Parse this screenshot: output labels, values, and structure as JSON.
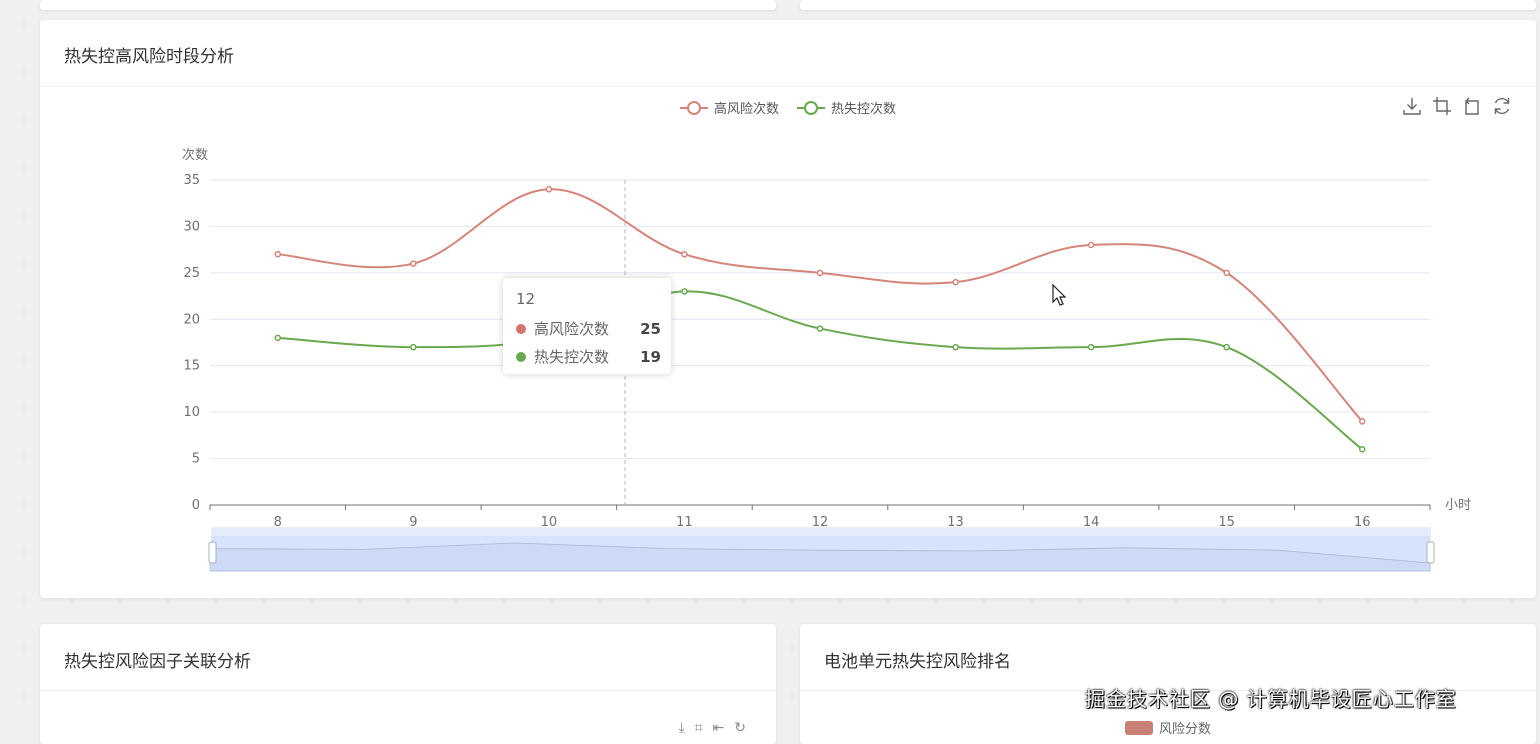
{
  "top_strip": {},
  "main_card": {
    "title": "热失控高风险时段分析"
  },
  "factor_card": {
    "title": "热失控风险因子关联分析"
  },
  "rank_card": {
    "title": "电池单元热失控风险排名",
    "legend_label": "风险分数"
  },
  "toolbox": {
    "icons": [
      "save-as-image-icon",
      "data-zoom-icon",
      "zoom-reset-icon",
      "restore-icon"
    ]
  },
  "tooltip": {
    "title": "12",
    "rows": [
      {
        "name": "高风险次数",
        "value": "25",
        "color": "#d4756b"
      },
      {
        "name": "热失控次数",
        "value": "19",
        "color": "#6aa84f"
      }
    ]
  },
  "watermark": {
    "text": "掘金技术社区 @ 计算机毕设匠心工作室"
  },
  "colors": {
    "risk": "#d4857a",
    "thermal": "#6aa84f",
    "axis": "#6e7079",
    "grid": "#e0e6f1",
    "zoom_fill": "#d7e3fa",
    "zoom_border": "#acb8d1"
  },
  "chart_data": {
    "type": "line",
    "smooth": true,
    "x": [
      "8",
      "9",
      "10",
      "11",
      "12",
      "13",
      "14",
      "15",
      "16"
    ],
    "xlabel": "小时",
    "ylabel": "次数",
    "ylim": [
      0,
      35
    ],
    "yticks": [
      0,
      5,
      10,
      15,
      20,
      25,
      30,
      35
    ],
    "grid": true,
    "legend_position": "top-center",
    "series": [
      {
        "name": "高风险次数",
        "values": [
          27,
          26,
          34,
          27,
          25,
          24,
          28,
          25,
          9
        ]
      },
      {
        "name": "热失控次数",
        "values": [
          18,
          17,
          18,
          23,
          19,
          17,
          17,
          17,
          6
        ]
      }
    ],
    "hovered_category": "12",
    "data_zoom": "slider"
  }
}
